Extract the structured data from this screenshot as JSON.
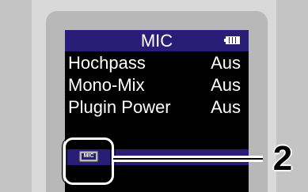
{
  "screen": {
    "title": "MIC",
    "battery_icon": "battery-full-icon",
    "menu_items": [
      {
        "label": "Hochpass",
        "value": "Aus"
      },
      {
        "label": "Mono-Mix",
        "value": "Aus"
      },
      {
        "label": "Plugin Power",
        "value": "Aus"
      }
    ],
    "tab_label": "MIC"
  },
  "callout": {
    "number": "2"
  },
  "colors": {
    "title_bar": "#2a1d78",
    "screen_bg": "#000000",
    "text": "#ffffff"
  }
}
